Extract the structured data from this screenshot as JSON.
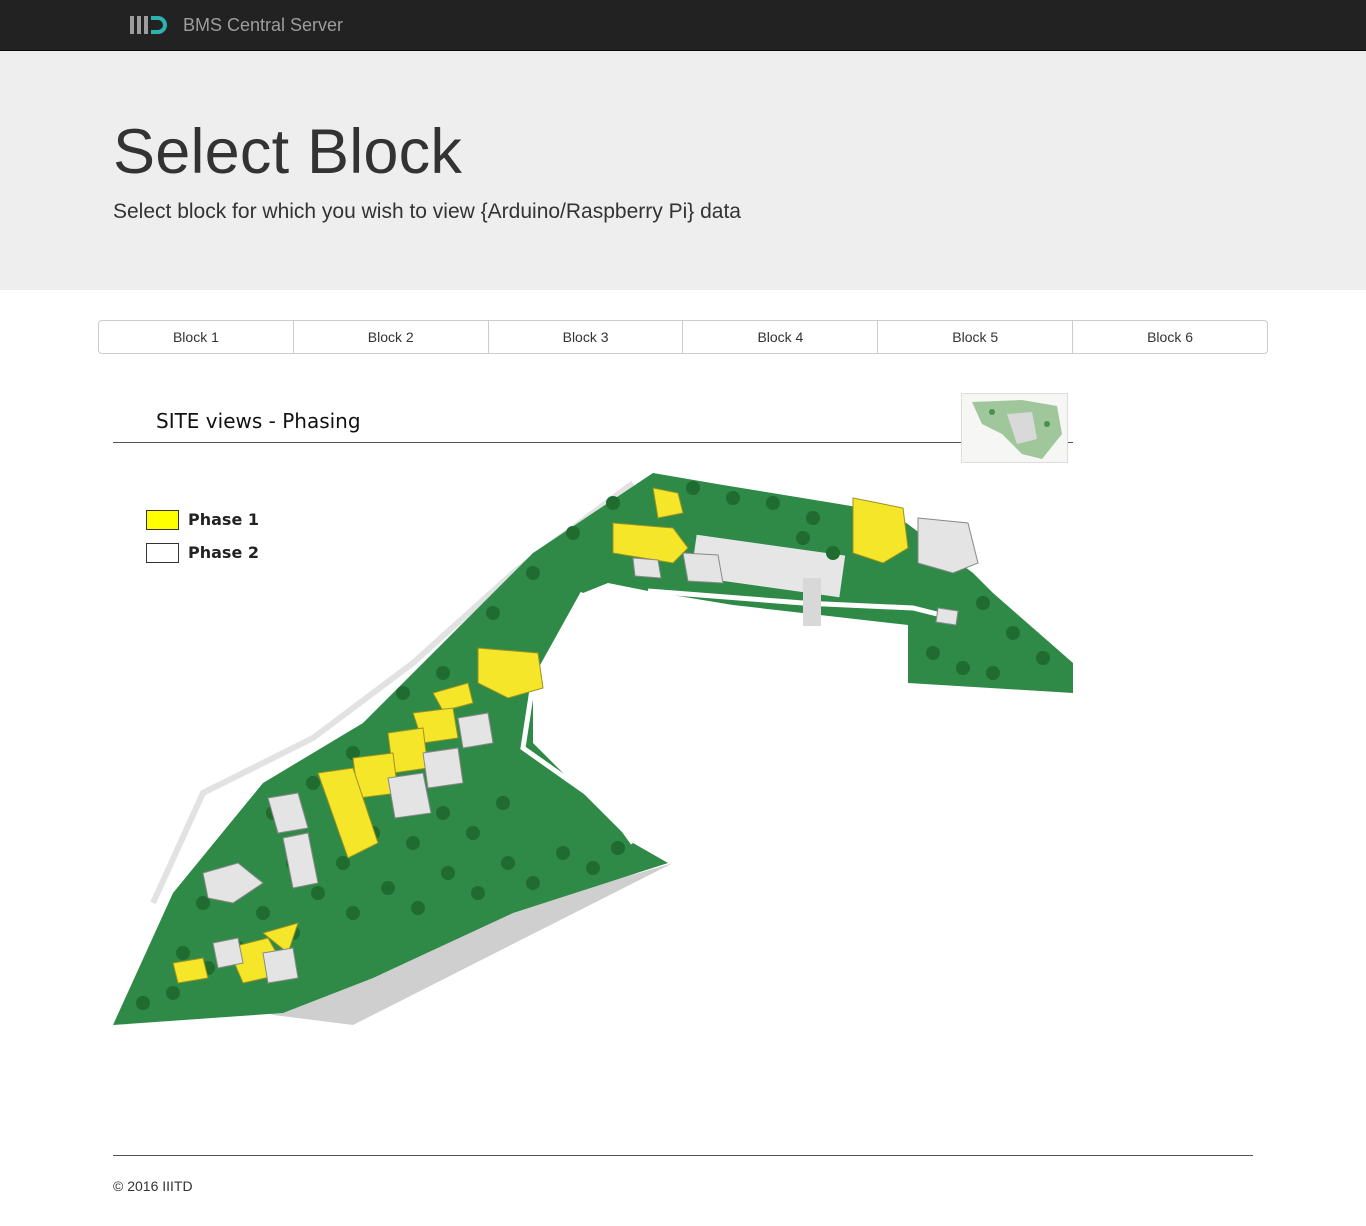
{
  "navbar": {
    "brand_text": "BMS Central Server",
    "logo_icon": "iiitd-logo-icon"
  },
  "jumbotron": {
    "title": "Select Block",
    "subtitle": "Select block for which you wish to view {Arduino/Raspberry Pi} data"
  },
  "blocks": {
    "b1": "Block 1",
    "b2": "Block 2",
    "b3": "Block 3",
    "b4": "Block 4",
    "b5": "Block 5",
    "b6": "Block 6"
  },
  "site_map": {
    "title": "SITE views - Phasing",
    "legend": {
      "phase1": "Phase 1",
      "phase2": "Phase 2"
    },
    "colors": {
      "phase1": "#ffff00",
      "phase2": "#ffffff",
      "grass": "#2e8a46",
      "tree": "#1f6b30"
    }
  },
  "footer": {
    "copyright": "© 2016 IIITD"
  }
}
